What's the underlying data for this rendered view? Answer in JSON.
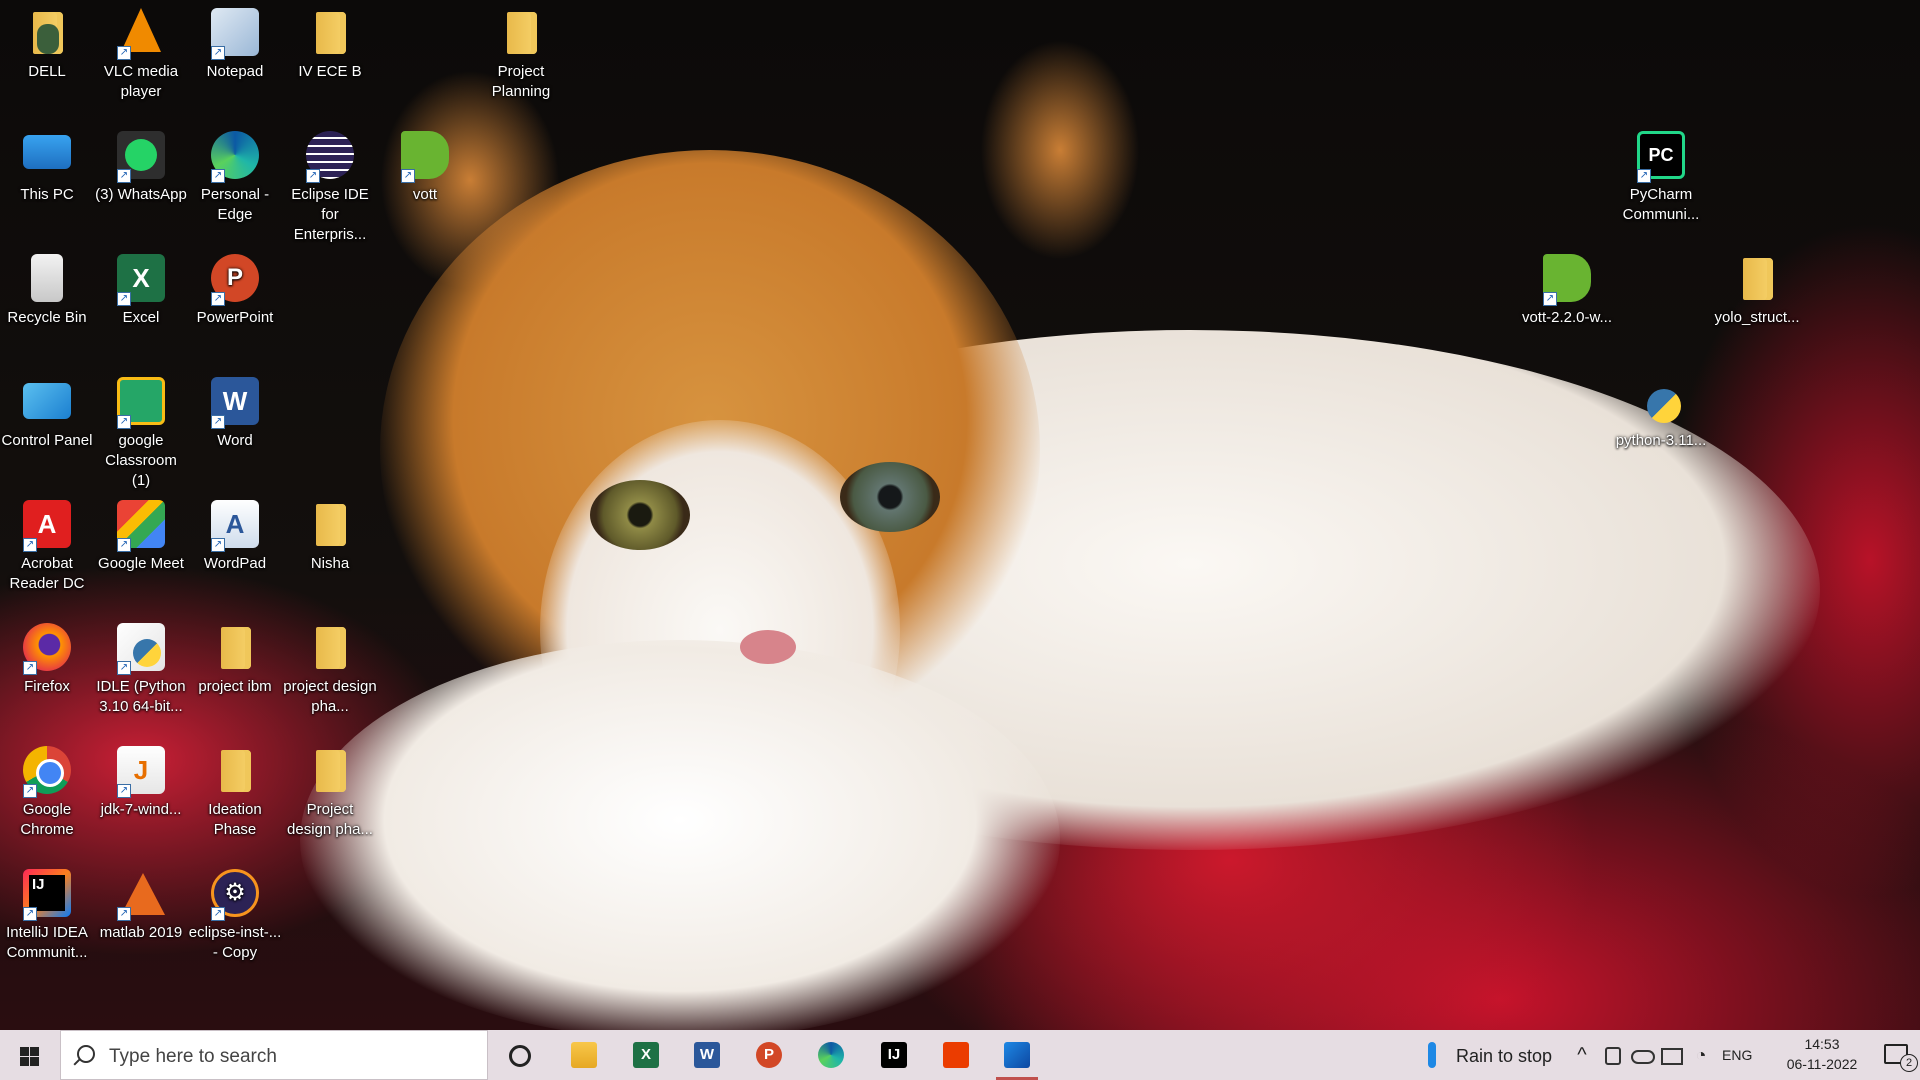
{
  "desktop_icons": [
    {
      "key": "dell",
      "label": "DELL",
      "kind": "folder-user"
    },
    {
      "key": "vlc",
      "label": "VLC media player",
      "kind": "vlc"
    },
    {
      "key": "notepad",
      "label": "Notepad",
      "kind": "notepad"
    },
    {
      "key": "iv-ece-b",
      "label": "IV ECE B",
      "kind": "folder"
    },
    {
      "key": "project-planning",
      "label": "Project Planning",
      "kind": "folder"
    },
    {
      "key": "this-pc",
      "label": "This PC",
      "kind": "pc"
    },
    {
      "key": "whatsapp",
      "label": "(3) WhatsApp",
      "kind": "whatsapp"
    },
    {
      "key": "edge",
      "label": "Personal - Edge",
      "kind": "edge"
    },
    {
      "key": "eclipse-ide",
      "label": "Eclipse IDE for Enterpris...",
      "kind": "eclipse"
    },
    {
      "key": "vott",
      "label": "vott",
      "kind": "tag"
    },
    {
      "key": "recycle-bin",
      "label": "Recycle Bin",
      "kind": "bin"
    },
    {
      "key": "excel",
      "label": "Excel",
      "kind": "excel"
    },
    {
      "key": "powerpoint",
      "label": "PowerPoint",
      "kind": "powerpoint"
    },
    {
      "key": "control-panel",
      "label": "Control Panel",
      "kind": "control"
    },
    {
      "key": "google-classroom",
      "label": "google Classroom (1)",
      "kind": "classroom"
    },
    {
      "key": "word",
      "label": "Word",
      "kind": "word"
    },
    {
      "key": "acrobat",
      "label": "Acrobat Reader DC",
      "kind": "acrobat"
    },
    {
      "key": "google-meet",
      "label": "Google Meet",
      "kind": "meet"
    },
    {
      "key": "wordpad",
      "label": "WordPad",
      "kind": "wordpad"
    },
    {
      "key": "nisha",
      "label": "Nisha",
      "kind": "folder"
    },
    {
      "key": "firefox",
      "label": "Firefox",
      "kind": "firefox"
    },
    {
      "key": "idle",
      "label": "IDLE (Python 3.10 64-bit...",
      "kind": "idle"
    },
    {
      "key": "project-ibm",
      "label": "project ibm",
      "kind": "folder"
    },
    {
      "key": "project-design-1",
      "label": "project design pha...",
      "kind": "folder"
    },
    {
      "key": "chrome",
      "label": "Google Chrome",
      "kind": "chrome"
    },
    {
      "key": "jdk",
      "label": "jdk-7-wind...",
      "kind": "jdk"
    },
    {
      "key": "ideation",
      "label": "Ideation Phase",
      "kind": "folder"
    },
    {
      "key": "project-design-2",
      "label": "Project design pha...",
      "kind": "folder"
    },
    {
      "key": "intellij",
      "label": "IntelliJ IDEA Communit...",
      "kind": "intellij"
    },
    {
      "key": "matlab",
      "label": "matlab 2019",
      "kind": "matlab"
    },
    {
      "key": "eclipse-inst",
      "label": "eclipse-inst-... - Copy",
      "kind": "eclipse-inst"
    },
    {
      "key": "pycharm",
      "label": "PyCharm Communi...",
      "kind": "pycharm"
    },
    {
      "key": "vott-installer",
      "label": "vott-2.2.0-w...",
      "kind": "tag"
    },
    {
      "key": "yolo",
      "label": "yolo_struct...",
      "kind": "folder"
    },
    {
      "key": "python-installer",
      "label": "python-3.11...",
      "kind": "python"
    }
  ],
  "taskbar": {
    "search_placeholder": "Type here to search",
    "pinned": [
      {
        "key": "cortana",
        "label": "O"
      },
      {
        "key": "file-explorer",
        "label": ""
      },
      {
        "key": "excel",
        "label": "X"
      },
      {
        "key": "word",
        "label": "W"
      },
      {
        "key": "powerpoint",
        "label": "P"
      },
      {
        "key": "edge",
        "label": ""
      },
      {
        "key": "intellij",
        "label": "IJ"
      },
      {
        "key": "office",
        "label": ""
      },
      {
        "key": "photos",
        "label": ""
      }
    ],
    "weather": "Rain to stop",
    "language": "ENG",
    "time": "14:53",
    "date": "06-11-2022",
    "notifications": "2"
  },
  "colors": {
    "taskbar": "#e6dde3",
    "excel": "#1e7145",
    "word": "#2b579a",
    "powerpoint": "#d24726",
    "accent_bar": "#c0504d"
  }
}
